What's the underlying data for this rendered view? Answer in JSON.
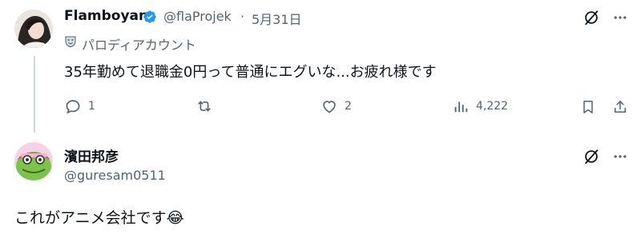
{
  "tweet": {
    "author_name": "Flamboyan",
    "verified": true,
    "handle": "@flaProjek",
    "separator": "·",
    "date": "5月31日",
    "label": "パロディアカウント",
    "text": "35年勤めて退職金0円って普通にエグいな...お疲れ様です",
    "actions": {
      "replies": "1",
      "retweets": "",
      "likes": "2",
      "views": "4,222"
    }
  },
  "reply": {
    "author_name": "濱田邦彦",
    "handle": "@guresam0511",
    "text": "これがアニメ会社です😂"
  },
  "icons": {
    "verified": "verified-badge-icon",
    "grok": "grok-icon",
    "more": "more-icon",
    "parody": "parody-mask-icon",
    "reply": "reply-icon",
    "retweet": "retweet-icon",
    "like": "like-icon",
    "views": "views-icon",
    "bookmark": "bookmark-icon",
    "share": "share-icon"
  },
  "colors": {
    "verified": "#1d9bf0",
    "text": "#0f1419",
    "muted": "#536471",
    "line": "#cfd9de"
  }
}
